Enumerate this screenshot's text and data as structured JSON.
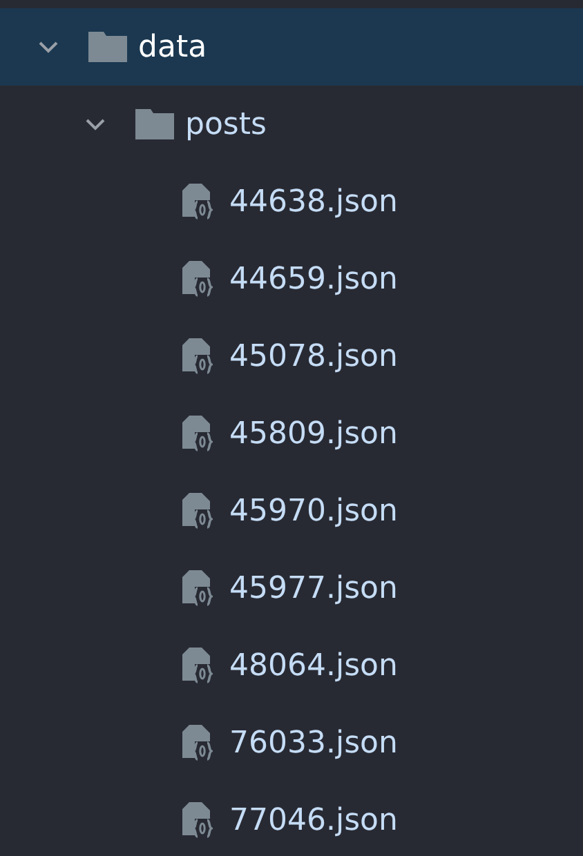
{
  "tree": [
    {
      "kind": "folder",
      "label": "data",
      "expanded": true,
      "selected": true,
      "children": [
        {
          "kind": "folder",
          "label": "posts",
          "expanded": true,
          "selected": false,
          "children": [
            {
              "kind": "file",
              "label": "44638.json",
              "selected": false
            },
            {
              "kind": "file",
              "label": "44659.json",
              "selected": false
            },
            {
              "kind": "file",
              "label": "45078.json",
              "selected": false
            },
            {
              "kind": "file",
              "label": "45809.json",
              "selected": false
            },
            {
              "kind": "file",
              "label": "45970.json",
              "selected": false
            },
            {
              "kind": "file",
              "label": "45977.json",
              "selected": false
            },
            {
              "kind": "file",
              "label": "48064.json",
              "selected": false
            },
            {
              "kind": "file",
              "label": "76033.json",
              "selected": false
            },
            {
              "kind": "file",
              "label": "77046.json",
              "selected": false
            }
          ]
        }
      ]
    }
  ]
}
